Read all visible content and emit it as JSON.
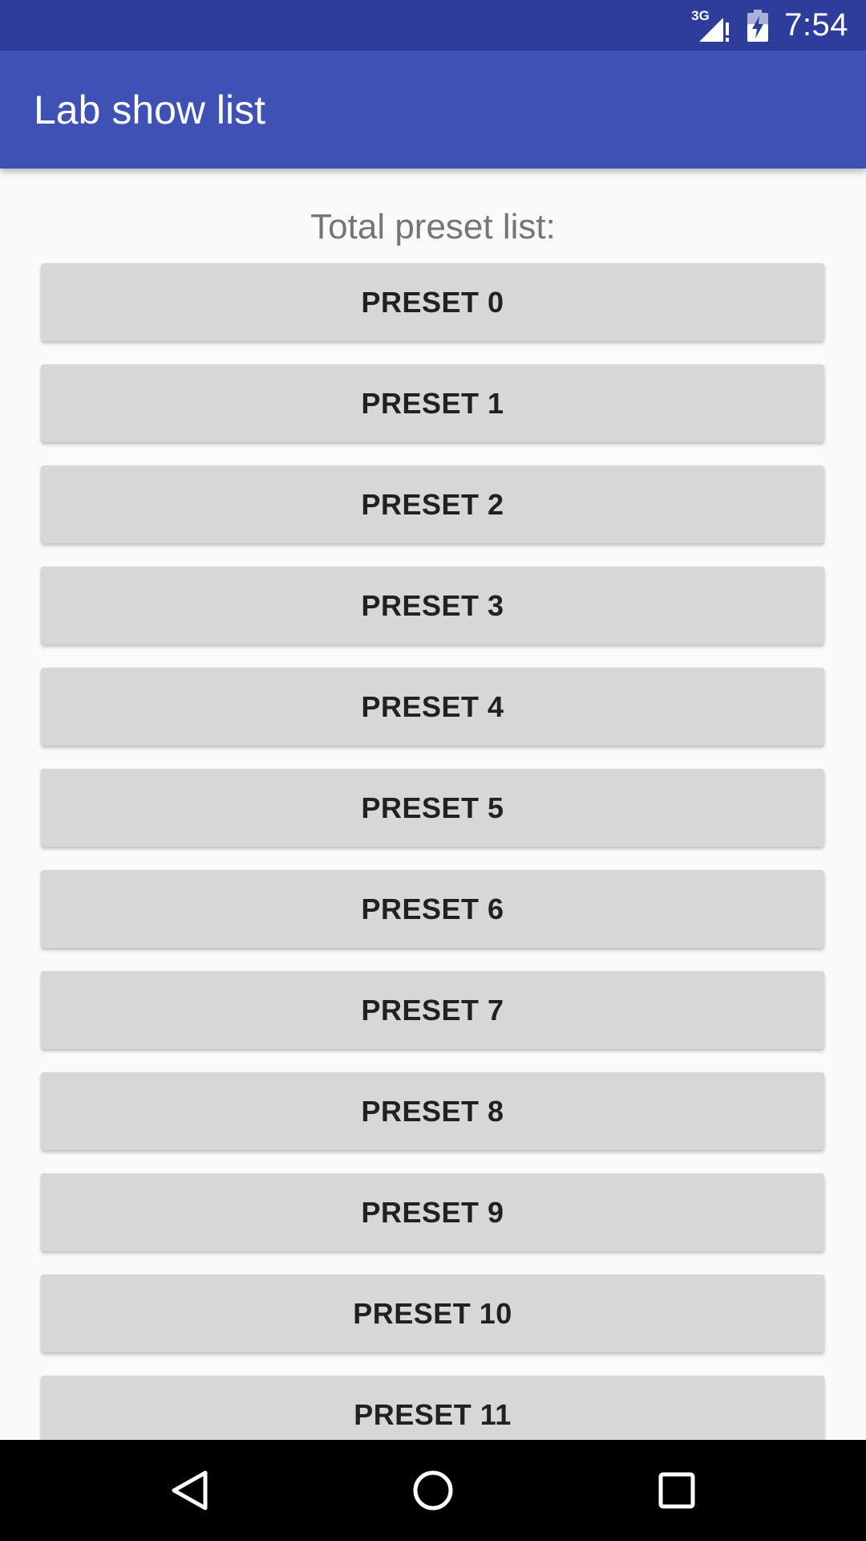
{
  "status_bar": {
    "network_type": "3G",
    "time": "7:54",
    "icons": [
      "signal-icon",
      "battery-charging-icon"
    ]
  },
  "app_bar": {
    "title": "Lab show list"
  },
  "content": {
    "label": "Total preset list:",
    "presets": [
      "PRESET 0",
      "PRESET 1",
      "PRESET 2",
      "PRESET 3",
      "PRESET 4",
      "PRESET 5",
      "PRESET 6",
      "PRESET 7",
      "PRESET 8",
      "PRESET 9",
      "PRESET 10",
      "PRESET 11"
    ]
  },
  "nav_bar": {
    "icons": [
      "back-icon",
      "home-icon",
      "recents-icon"
    ]
  },
  "colors": {
    "status_bar": "#2e3d9c",
    "app_bar": "#3f51b5",
    "background": "#fafafa",
    "button": "#d6d7d7",
    "button_text": "#212121",
    "label_text": "#757575",
    "nav_bar": "#000000"
  }
}
